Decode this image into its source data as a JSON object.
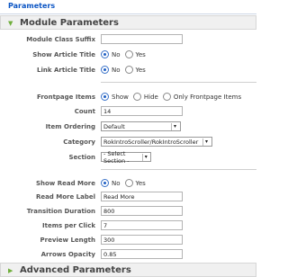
{
  "panel": {
    "title": "Parameters"
  },
  "sections": {
    "module": {
      "title": "Module Parameters"
    },
    "advanced": {
      "title": "Advanced Parameters"
    }
  },
  "fields": {
    "module_class_suffix": {
      "label": "Module Class Suffix",
      "value": ""
    },
    "show_article_title": {
      "label": "Show Article Title",
      "options": [
        "No",
        "Yes"
      ],
      "selected": "No"
    },
    "link_article_title": {
      "label": "Link Article Title",
      "options": [
        "No",
        "Yes"
      ],
      "selected": "No"
    },
    "frontpage_items": {
      "label": "Frontpage Items",
      "options": [
        "Show",
        "Hide",
        "Only Frontpage Items"
      ],
      "selected": "Show"
    },
    "count": {
      "label": "Count",
      "value": "14"
    },
    "item_ordering": {
      "label": "Item Ordering",
      "value": "Default"
    },
    "category": {
      "label": "Category",
      "value": "RokIntroScroller/RokIntroScroller"
    },
    "section": {
      "label": "Section",
      "value": "- Select Section -"
    },
    "show_read_more": {
      "label": "Show Read More",
      "options": [
        "No",
        "Yes"
      ],
      "selected": "No"
    },
    "read_more_label": {
      "label": "Read More Label",
      "value": "Read More"
    },
    "transition_duration": {
      "label": "Transition Duration",
      "value": "800"
    },
    "items_per_click": {
      "label": "Items per Click",
      "value": "7"
    },
    "preview_length": {
      "label": "Preview Length",
      "value": "300"
    },
    "arrows_opacity": {
      "label": "Arrows Opacity",
      "value": "0.85"
    }
  },
  "icons": {
    "expanded": "triangle-down-icon",
    "collapsed": "triangle-right-icon"
  },
  "colors": {
    "accent": "#0b55c4",
    "arrow": "#6fae3b"
  }
}
